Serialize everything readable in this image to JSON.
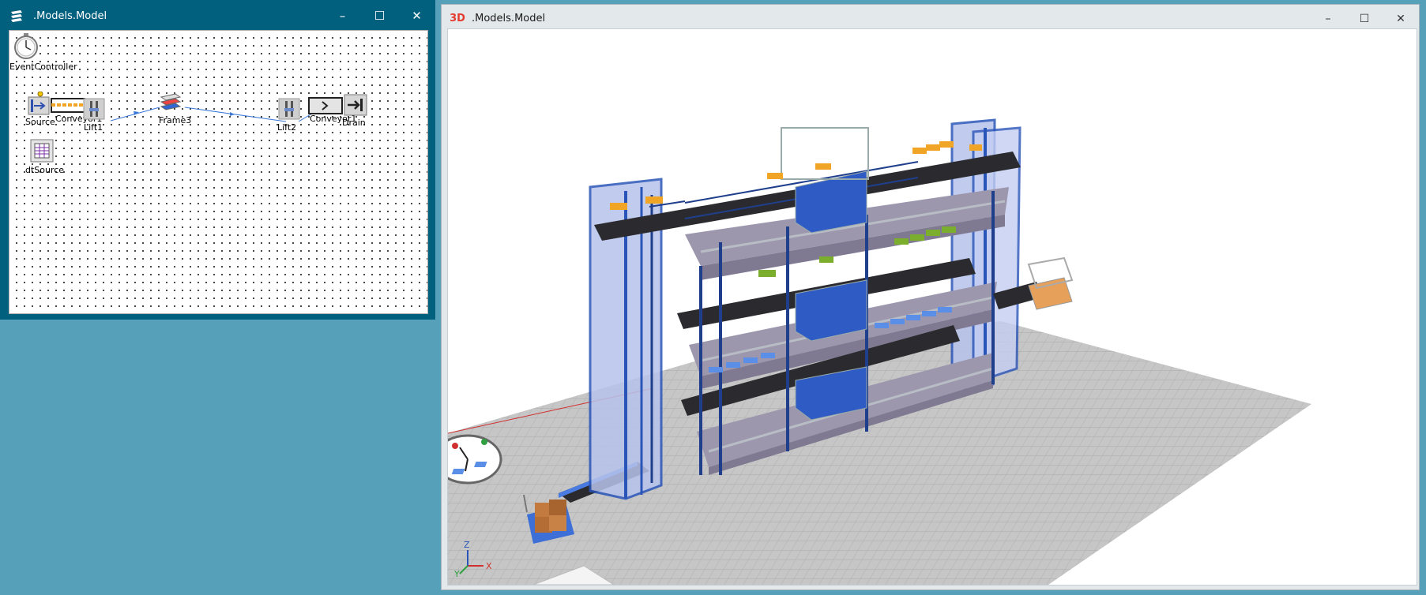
{
  "frame_window": {
    "title": ".Models.Model",
    "window_buttons": {
      "minimize": "–",
      "maximize": "☐",
      "close": "✕"
    },
    "objects": {
      "event_controller": "EventController",
      "source": "Source",
      "conveyor1": "Conveyor1",
      "lift1": "Lift1",
      "frame3": "Frame3",
      "lift2": "Lift2",
      "conveyor2": "Conveyor1",
      "drain": "Drain",
      "dt_source": "dtSource"
    }
  },
  "viewer_window": {
    "title": ".Models.Model",
    "badge": "3D",
    "window_buttons": {
      "minimize": "–",
      "maximize": "☐",
      "close": "✕"
    },
    "axes": {
      "x": "X",
      "y": "Y",
      "z": "Z"
    }
  },
  "colors": {
    "desktop": "#57a0b9",
    "frame_titlebar": "#02607f",
    "badge_3d": "#e43a2f",
    "structure_blue": "#2a55b8",
    "platform_gray": "#9c97ad",
    "belt_dark": "#333338",
    "pallet_orange": "#f0a526",
    "pallet_green": "#7cae2e",
    "pallet_blue": "#5b8ee6",
    "floor_gray": "#c4c4c4"
  }
}
